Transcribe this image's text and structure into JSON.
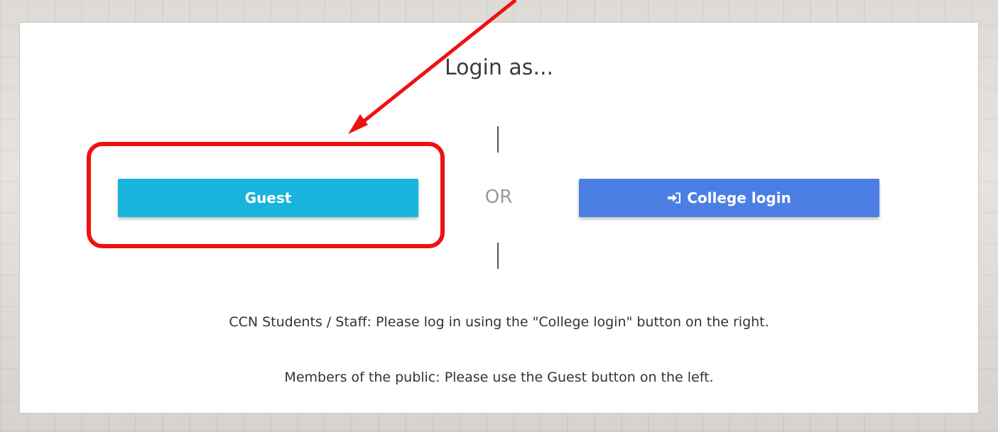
{
  "page": {
    "title": "Login as...",
    "or_label": "OR"
  },
  "buttons": {
    "guest_label": "Guest",
    "college_label": "College login"
  },
  "notes": {
    "students": "CCN Students / Staff: Please log in using the \"College login\" button on the right.",
    "public": "Members of the public: Please use the Guest button on the left."
  },
  "colors": {
    "guest_button": "#18b4dc",
    "college_button": "#4b7fe4",
    "annotation": "#ee1111"
  },
  "icons": {
    "college_button_icon": "sign-in-icon",
    "annotation_arrow": "arrow-icon"
  }
}
